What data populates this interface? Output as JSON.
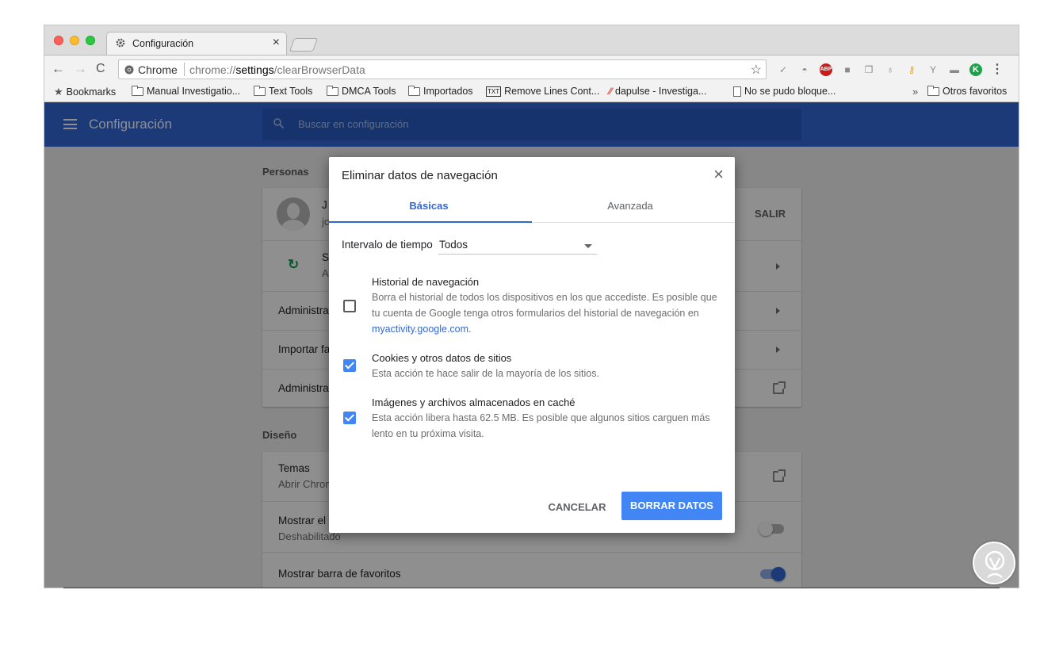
{
  "browser": {
    "tab_title": "Configuración",
    "tab_close": "×",
    "nav": {
      "back": "←",
      "forward": "→",
      "reload": "C"
    },
    "omnibox": {
      "origin_label": "Chrome",
      "url_scheme": "chrome://",
      "url_host": "settings",
      "url_path": "/clearBrowserData"
    },
    "extensions": [
      "pin-icon",
      "helmet-icon",
      "adblock-plus-icon",
      "grey-square-icon",
      "copy-icon",
      "lightbulb-icon",
      "key-icon",
      "plant-icon",
      "cup-icon",
      "k-icon",
      "menu-icon"
    ],
    "adblock_label": "ABP",
    "k_label": "K",
    "menu_label": "⋮",
    "bookmarks": [
      {
        "label": "Bookmarks",
        "icon": "star-icon"
      },
      {
        "label": "Manual Investigatio...",
        "icon": "folder-icon"
      },
      {
        "label": "Text Tools",
        "icon": "folder-icon"
      },
      {
        "label": "DMCA Tools",
        "icon": "folder-icon"
      },
      {
        "label": "Importados",
        "icon": "folder-icon"
      },
      {
        "label": "Remove Lines Cont...",
        "icon": "tx-icon"
      },
      {
        "label": "dapulse - Investiga...",
        "icon": "dapulse-icon"
      },
      {
        "label": "No se pudo bloque...",
        "icon": "page-icon"
      }
    ],
    "bookmarks_overflow": "»",
    "other_bookmarks": "Otros favoritos",
    "tx_label": "TXT"
  },
  "settings": {
    "app_title": "Configuración",
    "search_placeholder": "Buscar en configuración",
    "section_people": "Personas",
    "profile_initial": "J",
    "profile_email_initial": "jc",
    "signout_label": "SALIR",
    "sync_initial": "S",
    "sync_sub_initial": "A",
    "row_manage": "Administrar",
    "row_import": "Importar fa",
    "row_manage2": "Administrar",
    "section_design": "Diseño",
    "themes_label": "Temas",
    "themes_sub": "Abrir Chrom",
    "home_label": "Mostrar el b",
    "home_sub": "Deshabilitado",
    "bookmarks_bar_label": "Mostrar barra de favoritos",
    "bookmarks_bar_on": true
  },
  "dialog": {
    "title": "Eliminar datos de navegación",
    "close": "×",
    "tabs": [
      {
        "label": "Básicas",
        "active": true
      },
      {
        "label": "Avanzada",
        "active": false
      }
    ],
    "time_range_label": "Intervalo de tiempo",
    "time_range_value": "Todos",
    "options": [
      {
        "title": "Historial de navegación",
        "description": "Borra el historial de todos los dispositivos en los que accediste. Es posible que tu cuenta de Google tenga otros formularios del historial de navegación en",
        "link": "myactivity.google.com",
        "suffix": ".",
        "checked": false
      },
      {
        "title": "Cookies y otros datos de sitios",
        "description": "Esta acción te hace salir de la mayoría de los sitios.",
        "checked": true
      },
      {
        "title": "Imágenes y archivos almacenados en caché",
        "description": "Esta acción libera hasta 62.5 MB. Es posible que algunos sitios carguen más lento en tu próxima visita.",
        "checked": true
      }
    ],
    "cancel_label": "CANCELAR",
    "confirm_label": "BORRAR DATOS"
  },
  "colors": {
    "appbar": "#3367d6",
    "accent": "#4285f4",
    "link": "#3367d6",
    "sync_green": "#0f9d58"
  }
}
